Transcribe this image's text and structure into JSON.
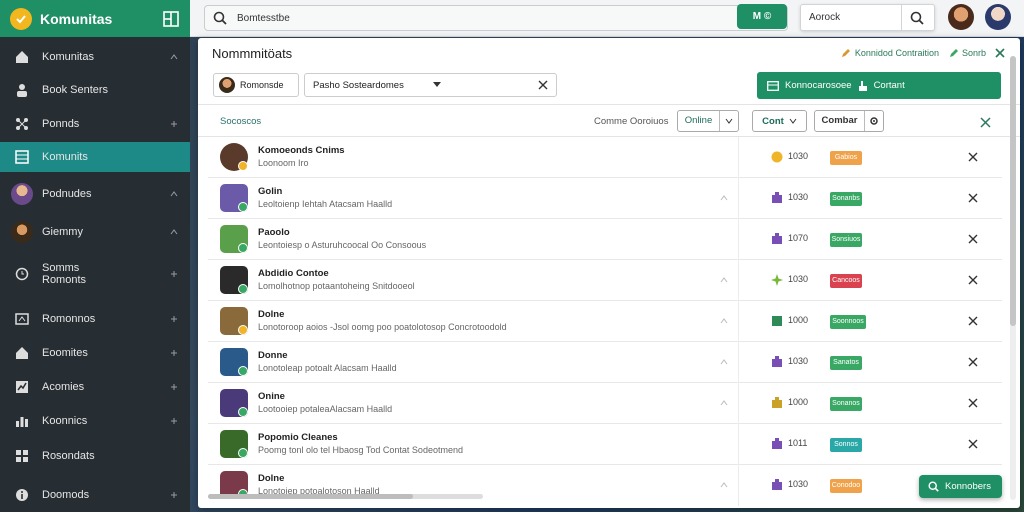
{
  "app": {
    "name": "Komunitas"
  },
  "sidebar": {
    "items": [
      {
        "label": "Komunitas",
        "icon": "home-icon"
      },
      {
        "label": "Book Senters",
        "icon": "people-icon"
      },
      {
        "label": "Ponnds",
        "icon": "network-icon"
      },
      {
        "label": "Komunits",
        "icon": "grid-icon",
        "active": true
      },
      {
        "label": "Podnudes",
        "icon": "avatar"
      },
      {
        "label": "Giemmy",
        "icon": "avatar"
      },
      {
        "label": "Somms",
        "label2": "Romonts",
        "icon": "clock-icon"
      },
      {
        "label": "Romonnos",
        "icon": "tag-icon"
      },
      {
        "label": "Eoomites",
        "icon": "home-icon"
      },
      {
        "label": "Acomies",
        "icon": "chart-icon"
      },
      {
        "label": "Koonnics",
        "icon": "bar-chart-icon"
      },
      {
        "label": "Rosondats",
        "icon": "list-icon"
      },
      {
        "label": "Doomods",
        "icon": "info-icon"
      }
    ]
  },
  "topbar": {
    "search_value": "Bomtesstbe",
    "green_button": "M ©",
    "search2_value": "Aorock"
  },
  "panel": {
    "title": "Nommmitöats",
    "head_link": "Konnidod Contraition",
    "head_link2": "Sonrb",
    "user_chip": "Romonsde",
    "sort_select": "Pasho Sosteardomes",
    "contact_button": "Konnocarosoee",
    "contact_button2": "Cortant",
    "toolbar": {
      "left": "Socoscos",
      "filter": "Comme Ooroiuos",
      "online": "Online",
      "count": "Cont",
      "contact": "Combar"
    }
  },
  "rows": [
    {
      "name": "Komoeonds Cnims",
      "desc": "Loonoom Iro",
      "count": "1030",
      "tag": "Gabios",
      "tag_color": "#f0a24a",
      "coin_color": "#f0b429",
      "badge_color": "#f0b429",
      "av_color": "#5a3a2a"
    },
    {
      "name": "Golin",
      "desc": "Leoltoienp Iehtah Atacsam Haalld",
      "count": "1030",
      "tag": "Sonanbs",
      "tag_color": "#3aa865",
      "coin_color": "#7a4fb5",
      "badge_color": "#3aa865",
      "av_color": "#6a5aa8"
    },
    {
      "name": "Paoolo",
      "desc": "Leontoiesp o Asturuhcoocal Oo Consoous",
      "count": "1070",
      "tag": "Sonsiuos",
      "tag_color": "#3aa865",
      "coin_color": "#7a4fb5",
      "badge_color": "#3aa865",
      "av_color": "#5aa04a"
    },
    {
      "name": "Abdidio Contoe",
      "desc": "Lomolhotnop potaantoheing Snitdooeol",
      "count": "1030",
      "tag": "Cancoos",
      "tag_color": "#d9424f",
      "coin_color": "#7ab83a",
      "badge_color": "#3aa865",
      "av_color": "#2a2a2a"
    },
    {
      "name": "Dolne",
      "desc": "Lonotoroop aoios -Jsol oomg poo poatolotosop Concrotoodold",
      "count": "1000",
      "tag": "Soonnoos",
      "tag_color": "#3aa865",
      "coin_color": "#2e8b57",
      "badge_color": "#f0b429",
      "av_color": "#8a6a3a"
    },
    {
      "name": "Donne",
      "desc": "Lonotoleap potoalt Alacsam Haalld",
      "count": "1030",
      "tag": "Sanatos",
      "tag_color": "#3aa865",
      "coin_color": "#7a4fb5",
      "badge_color": "#3aa865",
      "av_color": "#2a5a8a"
    },
    {
      "name": "Onine",
      "desc": "Lootooiep potaleaAlacsam Haalld",
      "count": "1000",
      "tag": "Sonanos",
      "tag_color": "#3aa865",
      "coin_color": "#c9a227",
      "badge_color": "#3aa865",
      "av_color": "#4a3a7a"
    },
    {
      "name": "Popomio Cleanes",
      "desc": "Poomg tonl olo tel Hbaosg Tod Contat Sodeotmend",
      "count": "1011",
      "tag": "Sonnos",
      "tag_color": "#2aa8a8",
      "coin_color": "#7a4fb5",
      "badge_color": "#3aa865",
      "av_color": "#3a6a2a"
    },
    {
      "name": "Dolne",
      "desc": "Lonotoiep potoalotoson Haalld",
      "count": "1030",
      "tag": "Conodoo",
      "tag_color": "#f0a24a",
      "coin_color": "#7a4fb5",
      "badge_color": "#3aa865",
      "av_color": "#7a3a4a"
    }
  ],
  "fab": {
    "label": "Konnobers"
  }
}
